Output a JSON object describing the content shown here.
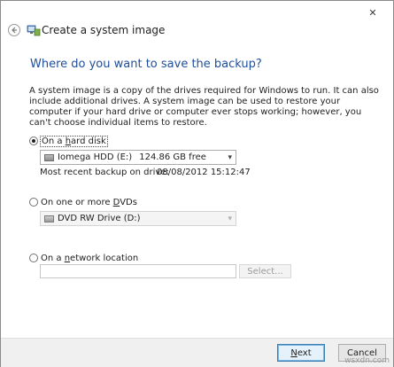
{
  "window": {
    "close_glyph": "✕",
    "title": "Create a system image"
  },
  "page": {
    "heading": "Where do you want to save the backup?",
    "description": "A system image is a copy of the drives required for Windows to run. It can also include additional drives. A system image can be used to restore your computer if your hard drive or computer ever stops working; however, you can't choose individual items to restore."
  },
  "options": {
    "hard_disk": {
      "label_prefix": "On a ",
      "label_accel": "h",
      "label_suffix": "ard disk",
      "selected": true,
      "drive_name": "Iomega HDD (E:)",
      "drive_free": "124.86 GB free",
      "recent_label": "Most recent backup on drive:",
      "recent_value": "08/08/2012 15:12:47"
    },
    "dvd": {
      "label_prefix": "On one or more ",
      "label_accel": "D",
      "label_suffix": "VDs",
      "selected": false,
      "drive_name": "DVD RW Drive (D:)"
    },
    "network": {
      "label_prefix": "On a ",
      "label_accel": "n",
      "label_suffix": "etwork location",
      "selected": false,
      "location_value": "",
      "select_button": "Select..."
    }
  },
  "footer": {
    "next_prefix": "",
    "next_accel": "N",
    "next_suffix": "ext",
    "cancel": "Cancel"
  },
  "watermark": "wsxdn.com",
  "colors": {
    "heading": "#1f4e9b",
    "footer_bg": "#f0f0f0",
    "default_button_border": "#3c7fb1"
  }
}
